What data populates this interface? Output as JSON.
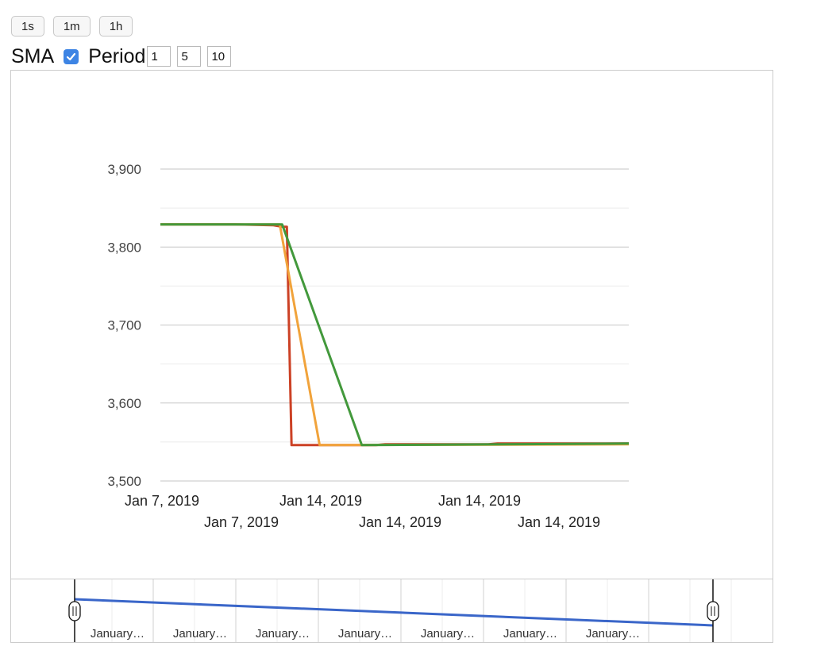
{
  "toolbar": {
    "buttons": [
      "1s",
      "1m",
      "1h"
    ]
  },
  "sma": {
    "label": "SMA",
    "checked": true,
    "period_label": "Period",
    "periods": [
      "1",
      "5",
      "10"
    ]
  },
  "colors": {
    "series_red": "#cc4125",
    "series_orange": "#f1a33b",
    "series_green": "#43993c",
    "range_line": "#3a66c9",
    "checkbox": "#3d84e4",
    "gridline": "#cccccc"
  },
  "chart_data": {
    "type": "line",
    "ylim": [
      3500,
      3900
    ],
    "y_ticks": [
      "3,500",
      "3,600",
      "3,700",
      "3,800",
      "3,900"
    ],
    "y_tick_values": [
      3500,
      3600,
      3700,
      3800,
      3900
    ],
    "x_tick_labels_row1": [
      "Jan 7, 2019",
      "Jan 14, 2019",
      "Jan 14, 2019"
    ],
    "x_tick_labels_row2": [
      "Jan 7, 2019",
      "Jan 14, 2019",
      "Jan 14, 2019"
    ],
    "grid": true,
    "series": [
      {
        "color": "#cc4125",
        "points": [
          [
            0,
            3829
          ],
          [
            0.16,
            3829
          ],
          [
            0.24,
            3828
          ],
          [
            0.26,
            3826
          ],
          [
            0.27,
            3826
          ],
          [
            0.28,
            3546
          ],
          [
            0.46,
            3546
          ],
          [
            0.48,
            3547
          ],
          [
            0.7,
            3547
          ],
          [
            0.72,
            3548
          ],
          [
            1,
            3548
          ]
        ]
      },
      {
        "color": "#f1a33b",
        "points": [
          [
            0,
            3829
          ],
          [
            0.255,
            3829
          ],
          [
            0.34,
            3546
          ],
          [
            1,
            3547
          ]
        ]
      },
      {
        "color": "#43993c",
        "points": [
          [
            0,
            3829
          ],
          [
            0.26,
            3829
          ],
          [
            0.43,
            3546
          ],
          [
            1,
            3548
          ]
        ]
      }
    ],
    "range_selector": {
      "labels": [
        "January…",
        "January…",
        "January…",
        "January…",
        "January…",
        "January…",
        "January…"
      ],
      "line": [
        [
          0,
          0.28
        ],
        [
          1,
          0.72
        ]
      ]
    }
  }
}
